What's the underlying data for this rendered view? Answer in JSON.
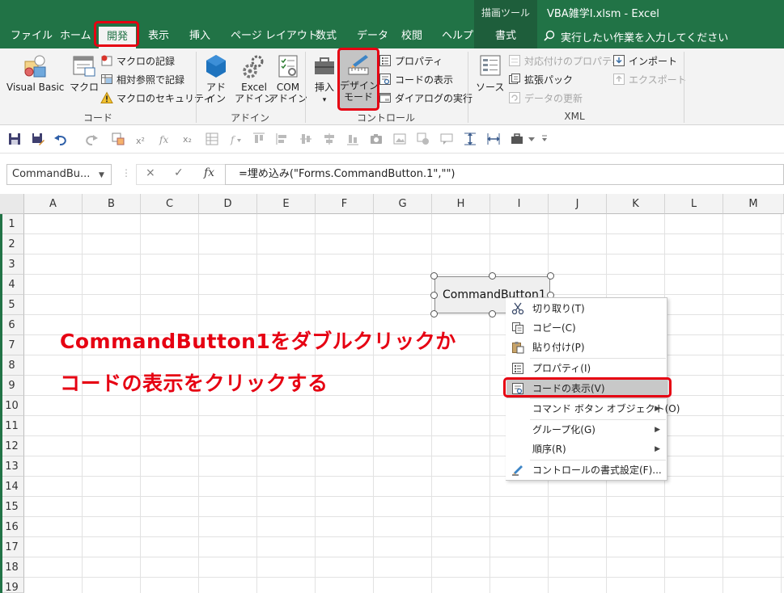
{
  "titlebar": {
    "context_tools": "描画ツール",
    "document_title": "VBA雑学Ⅰ.xlsm  -  Excel"
  },
  "tabs": [
    {
      "label": "ファイル"
    },
    {
      "label": "ホーム"
    },
    {
      "label": "開発",
      "active": true
    },
    {
      "label": "表示"
    },
    {
      "label": "挿入"
    },
    {
      "label": "ページ レイアウト"
    },
    {
      "label": "数式"
    },
    {
      "label": "データ"
    },
    {
      "label": "校閲"
    },
    {
      "label": "ヘルプ"
    },
    {
      "label": "書式"
    }
  ],
  "search": {
    "placeholder": "実行したい作業を入力してください"
  },
  "ribbon": {
    "code": {
      "label": "コード",
      "visual_basic": "Visual Basic",
      "macro": "マクロ",
      "record_macro": "マクロの記録",
      "relative_ref": "相対参照で記録",
      "macro_security": "マクロのセキュリティ"
    },
    "addins": {
      "label": "アドイン",
      "addin_1": "アド",
      "addin_2": "イン",
      "excel_addin_1": "Excel",
      "excel_addin_2": "アドイン",
      "com_addin_1": "COM",
      "com_addin_2": "アドイン"
    },
    "controls": {
      "label": "コントロール",
      "insert": "挿入",
      "design_mode_1": "デザイン",
      "design_mode_2": "モード",
      "properties": "プロパティ",
      "view_code": "コードの表示",
      "run_dialog": "ダイアログの実行"
    },
    "xml": {
      "label": "XML",
      "source": "ソース",
      "map_properties": "対応付けのプロパティ",
      "expansion_packs": "拡張パック",
      "refresh_data": "データの更新",
      "import": "インポート",
      "export": "エクスポート"
    }
  },
  "formula_bar": {
    "name_box": "CommandBu...",
    "cancel": "×",
    "enter": "✓",
    "fx": "fx",
    "formula": "=埋め込み(\"Forms.CommandButton.1\",\"\")"
  },
  "columns": [
    "A",
    "B",
    "C",
    "D",
    "E",
    "F",
    "G",
    "H",
    "I",
    "J",
    "K",
    "L",
    "M"
  ],
  "rows": [
    "1",
    "2",
    "3",
    "4",
    "5",
    "6",
    "7",
    "8",
    "9",
    "10",
    "11",
    "12",
    "13",
    "14",
    "15",
    "16",
    "17",
    "18",
    "19"
  ],
  "command_button": {
    "label": "CommandButton1"
  },
  "annotation": {
    "line1": "CommandButton1をダブルクリックか",
    "line2": "コードの表示をクリックする"
  },
  "context_menu": {
    "items": [
      {
        "label": "切り取り(T)",
        "icon": "scissors-icon"
      },
      {
        "label": "コピー(C)",
        "icon": "copy-icon"
      },
      {
        "label": "貼り付け(P)",
        "icon": "paste-icon"
      },
      {
        "label": "プロパティ(I)",
        "icon": "properties-icon"
      },
      {
        "label": "コードの表示(V)",
        "icon": "view-code-icon",
        "highlighted": true
      },
      {
        "label": "コマンド ボタン オブジェクト(O)",
        "submenu": true
      },
      {
        "label": "グループ化(G)",
        "submenu": true
      },
      {
        "label": "順序(R)",
        "submenu": true
      },
      {
        "label": "コントロールの書式設定(F)...",
        "icon": "format-control-icon"
      }
    ]
  },
  "colors": {
    "excel_green": "#217346",
    "highlight_red": "#e60012"
  }
}
